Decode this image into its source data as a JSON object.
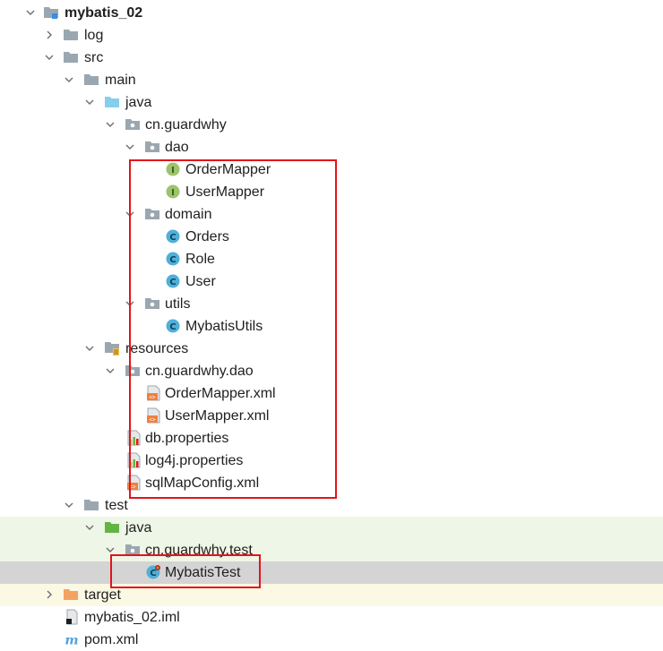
{
  "tree": {
    "root_label": "mybatis_02",
    "log": "log",
    "src": "src",
    "main": "main",
    "java_main": "java",
    "pkg_main": "cn.guardwhy",
    "dao": "dao",
    "order_mapper": "OrderMapper",
    "user_mapper": "UserMapper",
    "domain": "domain",
    "orders": "Orders",
    "role": "Role",
    "user": "User",
    "utils": "utils",
    "mybatis_utils": "MybatisUtils",
    "resources": "resources",
    "pkg_dao": "cn.guardwhy.dao",
    "order_mapper_xml": "OrderMapper.xml",
    "user_mapper_xml": "UserMapper.xml",
    "db_properties": "db.properties",
    "log4j_properties": "log4j.properties",
    "sqlmap_config": "sqlMapConfig.xml",
    "test": "test",
    "java_test": "java",
    "pkg_test": "cn.guardwhy.test",
    "mybatis_test": "MybatisTest",
    "target": "target",
    "iml": "mybatis_02.iml",
    "pom": "pom.xml"
  },
  "icons": {
    "folder": "folder-icon",
    "package": "package-icon",
    "interface": "interface-icon",
    "class": "class-icon",
    "xml": "xml-file-icon",
    "properties": "properties-file-icon",
    "maven": "maven-icon"
  },
  "colors": {
    "folder_gray": "#9aa7b0",
    "source_blue": "#87ceeb",
    "test_green": "#62b543",
    "target_orange": "#f4a261",
    "interface_green": "#9dc36b",
    "class_blue": "#4fb0d8",
    "highlight_red": "#e4131b"
  }
}
